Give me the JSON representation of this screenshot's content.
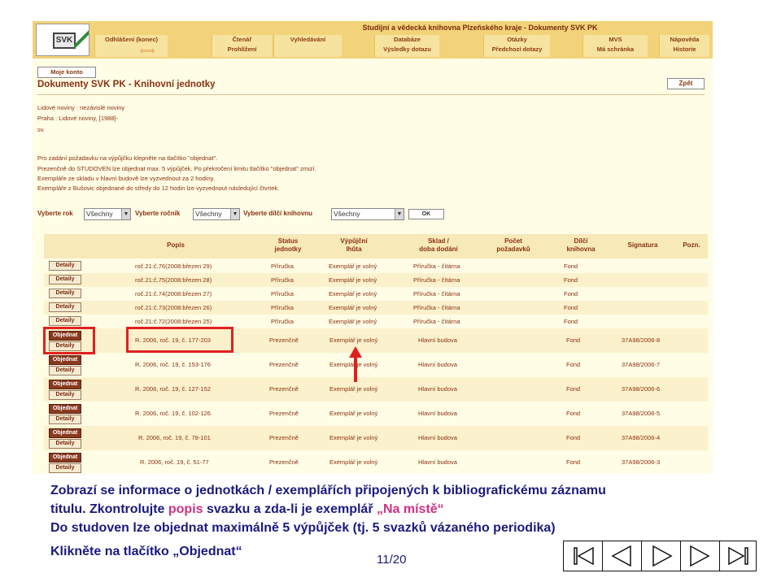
{
  "app": {
    "header_title": "Studijní a vědecká knihovna Plzeňského kraje - Dokumenty SVK PK",
    "logo_text": "SVK"
  },
  "nav": [
    {
      "line1": "Odhlášení (konec)",
      "line2": ""
    },
    {
      "line1": "Čtenář",
      "line2": "Prohlížení"
    },
    {
      "line1": "",
      "line2": "Vyhledávání"
    },
    {
      "line1": "Databáze",
      "line2": "Výsledky dotazu"
    },
    {
      "line1": "Otázky",
      "line2": "Předchozí dotazy"
    },
    {
      "line1": "MVS",
      "line2": "Má schránka"
    },
    {
      "line1": "Nápověda",
      "line2": "Historie"
    }
  ],
  "konto_button": "Moje konto",
  "page_heading": "Dokumenty SVK PK - Knihovní jednotky",
  "back_button": "Zpět",
  "record": {
    "title": "Lidové noviny : nezávislé noviny",
    "imprint": "Praha : Lidové noviny, [1988]-",
    "volume": "sv."
  },
  "info_lines": [
    "Pro zadání požadavku na výpůjčku klepněte na tlačítko \"objednat\".",
    "Prezenčně do STUDOVEN lze objednat max. 5 výpůjček. Po překročení limitu tlačítko \"objednat\" zmizí.",
    "Exempláře ze skladu v hlavní budově lze vyzvednout za 2 hodiny.",
    "Exempláře z Bušovic objednané do středy do 12 hodin lze vyzvednout následující čtvrtek."
  ],
  "filters": {
    "year_label": "Vyberte rok",
    "year_value": "Všechny",
    "volume_label": "Vyberte ročník",
    "volume_value": "Všechny",
    "branch_label": "Vyberte dílčí knihovnu",
    "branch_value": "Všechny",
    "ok_button": "OK"
  },
  "table": {
    "headers": {
      "popis": "Popis",
      "status1": "Status",
      "status2": "jednotky",
      "vyp1": "Výpůjční",
      "vyp2": "lhůta",
      "sklad1": "Sklad /",
      "sklad2": "doba dodání",
      "pocet1": "Počet",
      "pocet2": "požadavků",
      "dilci1": "Dílčí",
      "dilci2": "knihovna",
      "signatura": "Signatura",
      "pozn": "Pozn."
    },
    "detail_label": "Detaily",
    "order_label": "Objednat",
    "rows_a": [
      {
        "popis": "roč.21:č.76(2008:březen 29)",
        "status": "Příručka",
        "lhuta": "Exemplář je volný",
        "sklad": "Příručka - čítárna",
        "dilci": "Fond"
      },
      {
        "popis": "roč.21:č.75(2008:březen 28)",
        "status": "Příručka",
        "lhuta": "Exemplář je volný",
        "sklad": "Příručka - čítárna",
        "dilci": "Fond"
      },
      {
        "popis": "roč.21:č.74(2008:březen 27)",
        "status": "Příručka",
        "lhuta": "Exemplář je volný",
        "sklad": "Příručka - čítárna",
        "dilci": "Fond"
      },
      {
        "popis": "roč.21:č.73(2008:březen 26)",
        "status": "Příručka",
        "lhuta": "Exemplář je volný",
        "sklad": "Příručka - čítárna",
        "dilci": "Fond"
      },
      {
        "popis": "roč.21:č.72(2008:březen 25)",
        "status": "Příručka",
        "lhuta": "Exemplář je volný",
        "sklad": "Příručka - čítárna",
        "dilci": "Fond"
      }
    ],
    "rows_b": [
      {
        "popis": "R. 2006, roč. 19, č. 177-203",
        "status": "Prezenčně",
        "lhuta": "Exemplář je volný",
        "sklad": "Hlavní budova",
        "dilci": "Fond",
        "signatura": "37A98/2006-8"
      },
      {
        "popis": "R. 2006, roč. 19, č. 153-176",
        "status": "Prezenčně",
        "lhuta": "Exemplář je volný",
        "sklad": "Hlavní budova",
        "dilci": "Fond",
        "signatura": "37A98/2006-7"
      },
      {
        "popis": "R. 2006, roč. 19, č. 127-152",
        "status": "Prezenčně",
        "lhuta": "Exemplář je volný",
        "sklad": "Hlavní budova",
        "dilci": "Fond",
        "signatura": "37A98/2006-6"
      },
      {
        "popis": "R. 2006, roč. 19, č. 102-126",
        "status": "Prezenčně",
        "lhuta": "Exemplář je volný",
        "sklad": "Hlavní budova",
        "dilci": "Fond",
        "signatura": "37A98/2006-5"
      },
      {
        "popis": "R. 2006, roč. 19, č. 78-101",
        "status": "Prezenčně",
        "lhuta": "Exemplář je volný",
        "sklad": "Hlavní budova",
        "dilci": "Fond",
        "signatura": "37A98/2006-4"
      },
      {
        "popis": "R. 2006, roč. 19, č. 51-77",
        "status": "Prezenčně",
        "lhuta": "Exemplář je volný",
        "sklad": "Hlavní budova",
        "dilci": "Fond",
        "signatura": "37A98/2006-3"
      }
    ]
  },
  "caption": {
    "line1": "Zobrazí se informace o jednotkách / exemplářích připojených k bibliografickému záznamu",
    "line2_a": "titulu. Zkontrolujte ",
    "line2_popis": "popis",
    "line2_b": " svazku a zda-li je exemplář ",
    "line2_hl": "„Na místě“",
    "line3": "Do studoven lze objednat maximálně 5 výpůjček (tj. 5 svazků vázaného periodika)",
    "cta": "Klikněte na tlačítko „Objednat“"
  },
  "page_number": "11/20",
  "colors": {
    "accent_red": "#e02020",
    "caption_blue": "#1a1a80",
    "caption_pink": "#d03080",
    "ui_brown": "#8a3010"
  }
}
